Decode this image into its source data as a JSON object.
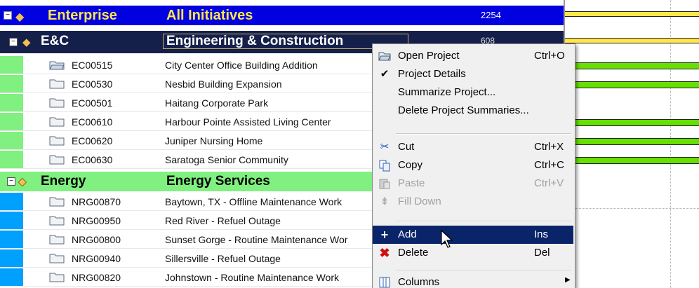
{
  "enterprise": {
    "code": "Enterprise",
    "name": "All Initiatives",
    "value": "2254"
  },
  "ec": {
    "code": "E&C",
    "name": "Engineering & Construction",
    "value": "608"
  },
  "ec_projects": [
    {
      "code": "EC00515",
      "name": "City Center Office Building Addition"
    },
    {
      "code": "EC00530",
      "name": "Nesbid Building Expansion"
    },
    {
      "code": "EC00501",
      "name": "Haitang Corporate Park"
    },
    {
      "code": "EC00610",
      "name": "Harbour Pointe Assisted Living Center"
    },
    {
      "code": "EC00620",
      "name": "Juniper Nursing Home"
    },
    {
      "code": "EC00630",
      "name": "Saratoga Senior Community"
    }
  ],
  "energy": {
    "code": "Energy",
    "name": "Energy Services"
  },
  "energy_projects": [
    {
      "code": "NRG00870",
      "name": "Baytown, TX - Offline Maintenance Work"
    },
    {
      "code": "NRG00950",
      "name": "Red River - Refuel Outage"
    },
    {
      "code": "NRG00800",
      "name": "Sunset Gorge - Routine Maintenance Wor"
    },
    {
      "code": "NRG00940",
      "name": "Sillersville - Refuel Outage"
    },
    {
      "code": "NRG00820",
      "name": "Johnstown - Routine Maintenance Work"
    }
  ],
  "menu": {
    "open_project": {
      "label": "Open Project",
      "shortcut": "Ctrl+O"
    },
    "project_details": {
      "label": "Project Details",
      "checked": true
    },
    "summarize_project": {
      "label": "Summarize Project..."
    },
    "delete_summaries": {
      "label": "Delete Project Summaries..."
    },
    "cut": {
      "label": "Cut",
      "shortcut": "Ctrl+X"
    },
    "copy": {
      "label": "Copy",
      "shortcut": "Ctrl+C"
    },
    "paste": {
      "label": "Paste",
      "shortcut": "Ctrl+V",
      "disabled": true
    },
    "fill_down": {
      "label": "Fill Down",
      "disabled": true
    },
    "add": {
      "label": "Add",
      "shortcut": "Ins",
      "selected": true
    },
    "delete": {
      "label": "Delete",
      "shortcut": "Del"
    },
    "columns": {
      "label": "Columns"
    }
  },
  "colors": {
    "enterprise_bg": "#0000e0",
    "enterprise_text": "#ffe64a",
    "ec_bg": "#14204a",
    "energy_bg": "#80f080",
    "bar_green": "#66e000",
    "menu_selected": "#0a246a"
  }
}
